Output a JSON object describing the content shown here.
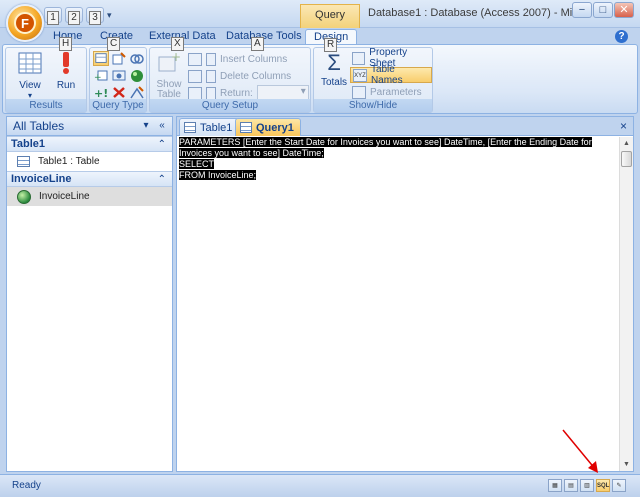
{
  "window": {
    "title": "Database1 : Database (Access 2007) - Mi...",
    "context_tab_title": "Query Tools",
    "buttons": [
      "−",
      "□",
      "✕"
    ]
  },
  "office_button": {
    "label": "F"
  },
  "qat": {
    "keytips": [
      "1",
      "2",
      "3"
    ]
  },
  "ribbon_tabs": [
    {
      "label": "Home",
      "keytip": "H"
    },
    {
      "label": "Create",
      "keytip": "C"
    },
    {
      "label": "External Data",
      "keytip": "X"
    },
    {
      "label": "Database Tools",
      "keytip": "A"
    },
    {
      "label": "Design",
      "keytip": "R"
    }
  ],
  "help": "?",
  "ribbon": {
    "results": {
      "label": "Results",
      "view": "View",
      "run": "Run"
    },
    "query_type": {
      "label": "Query Type"
    },
    "query_setup": {
      "label": "Query Setup",
      "show_table": "Show Table",
      "insert_columns": "Insert Columns",
      "delete_columns": "Delete Columns",
      "return": "Return:"
    },
    "show_hide": {
      "label": "Show/Hide",
      "totals": "Totals",
      "property_sheet": "Property Sheet",
      "table_names": "Table Names",
      "parameters": "Parameters",
      "xyz": "XYZ"
    }
  },
  "nav": {
    "header": "All Tables",
    "groups": [
      {
        "name": "Table1",
        "items": [
          {
            "label": "Table1 : Table",
            "icon": "table-icon"
          }
        ]
      },
      {
        "name": "InvoiceLine",
        "items": [
          {
            "label": "InvoiceLine",
            "icon": "query-icon"
          }
        ]
      }
    ]
  },
  "doc": {
    "tabs": [
      "Table1",
      "Query1"
    ],
    "close": "×",
    "sql_lines": [
      "PARAMETERS [Enter the Start Date for Invoices you want to see] DateTime, [Enter the Ending Date for",
      "Invoices you want to see] DateTime;",
      "SELECT",
      "FROM InvoiceLine;"
    ]
  },
  "status": {
    "text": "Ready",
    "view_buttons": [
      "▦",
      "▤",
      "▥",
      "SQL",
      "✎"
    ],
    "active_view": "SQL"
  },
  "colors": {
    "accent": "#f9c65b",
    "ribbon_blue": "#bfd3ee",
    "text_blue": "#15428b",
    "annotation_arrow": "#e00000"
  }
}
